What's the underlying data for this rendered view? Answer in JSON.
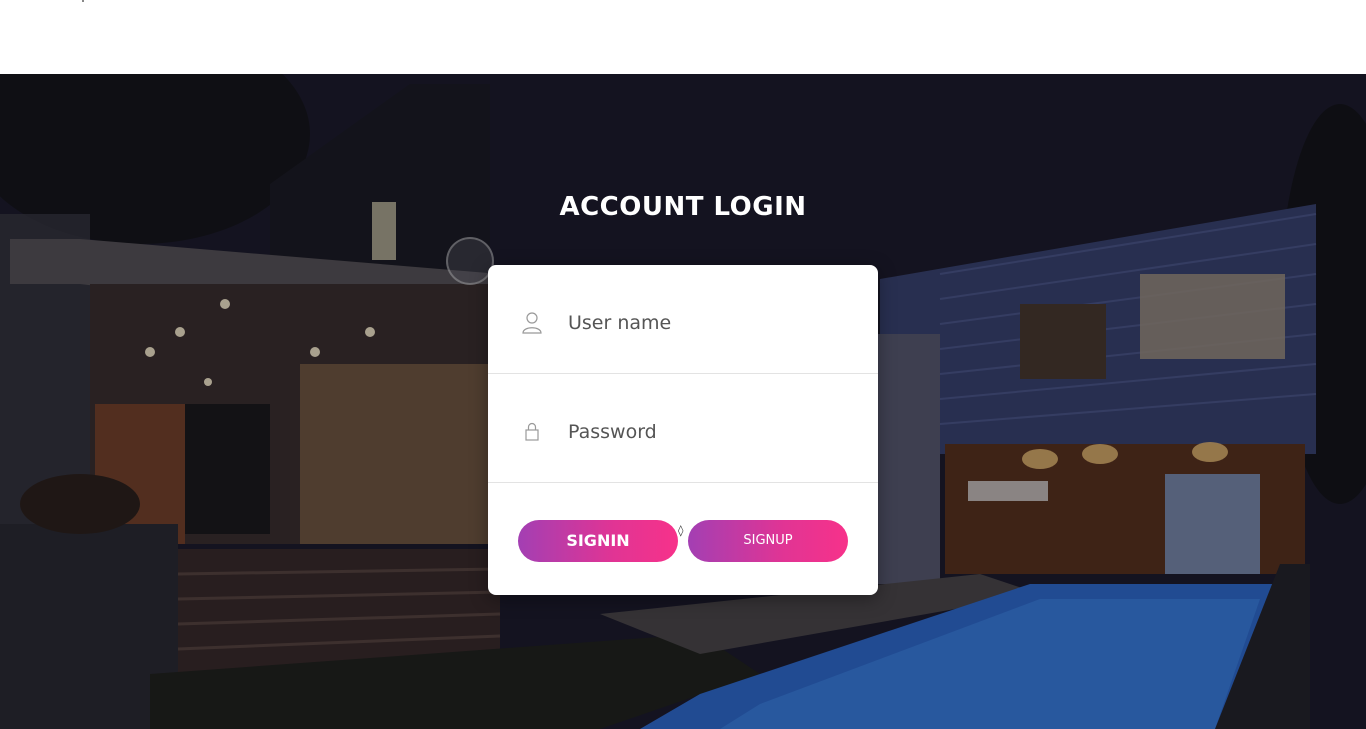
{
  "page": {
    "title": "ACCOUNT LOGIN"
  },
  "form": {
    "username": {
      "placeholder": "User name",
      "value": "",
      "icon": "user-icon"
    },
    "password": {
      "placeholder": "Password",
      "value": "",
      "icon": "lock-icon"
    },
    "separator_glyph": "◊",
    "signin_label": "SIGNIN",
    "signup_label": "SIGNUP"
  },
  "colors": {
    "button_gradient_start": "#a33fb3",
    "button_gradient_end": "#f7328a",
    "card_background": "#ffffff",
    "title_color": "#ffffff"
  }
}
